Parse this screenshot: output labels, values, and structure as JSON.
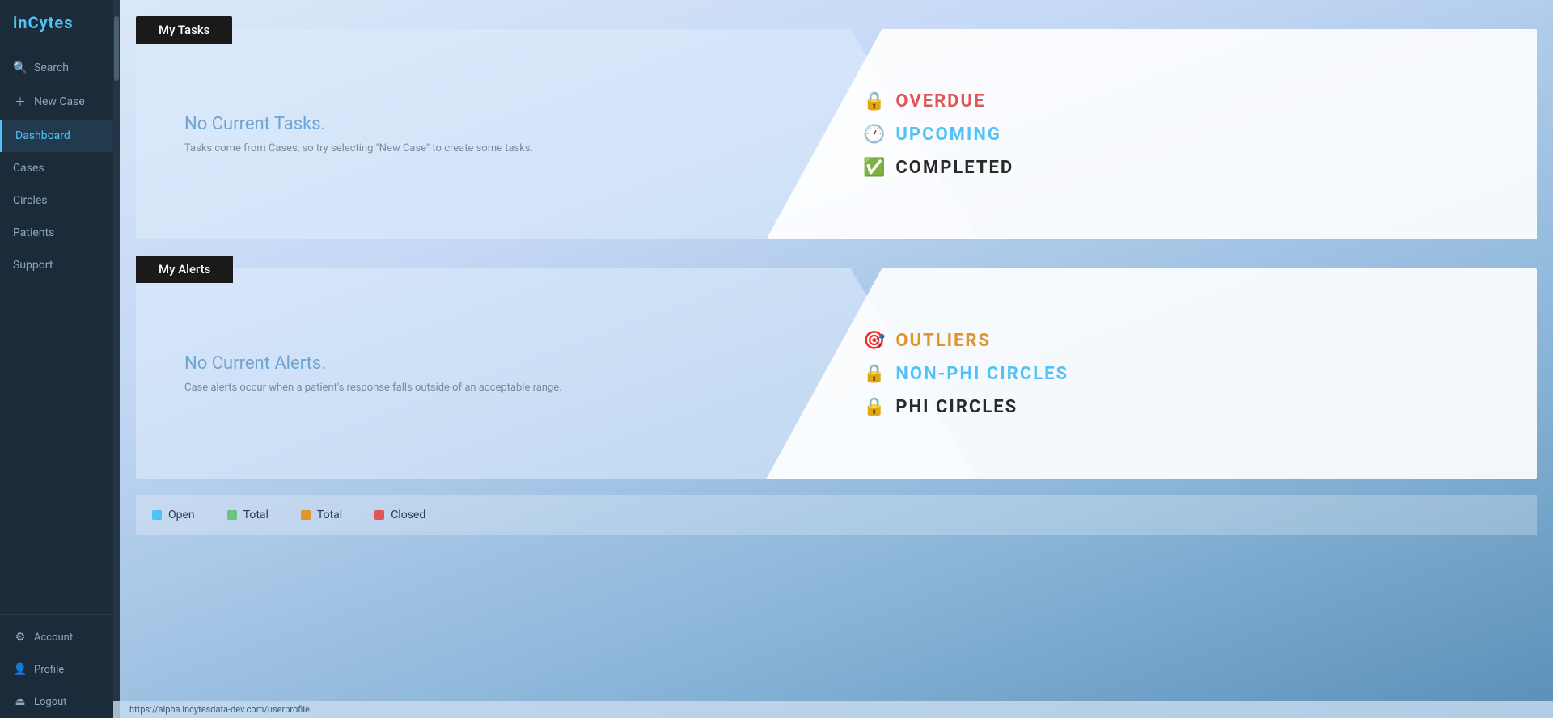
{
  "app": {
    "name": "inCytes"
  },
  "sidebar": {
    "logo": "inCytes",
    "items": [
      {
        "id": "search",
        "label": "Search",
        "icon": "🔍",
        "active": false
      },
      {
        "id": "new-case",
        "label": "New Case",
        "icon": "➕",
        "active": false
      },
      {
        "id": "dashboard",
        "label": "Dashboard",
        "icon": "",
        "active": true
      },
      {
        "id": "cases",
        "label": "Cases",
        "icon": "",
        "active": false
      },
      {
        "id": "circles",
        "label": "Circles",
        "icon": "",
        "active": false
      },
      {
        "id": "patients",
        "label": "Patients",
        "icon": "",
        "active": false
      },
      {
        "id": "support",
        "label": "Support",
        "icon": "",
        "active": false
      }
    ],
    "bottom_items": [
      {
        "id": "account",
        "label": "Account",
        "icon": "⚙"
      },
      {
        "id": "profile",
        "label": "Profile",
        "icon": "👤"
      },
      {
        "id": "logout",
        "label": "Logout",
        "icon": "⏏"
      }
    ]
  },
  "tasks_section": {
    "label": "My Tasks",
    "no_items_title": "No Current Tasks.",
    "no_items_subtitle": "Tasks come from Cases, so try selecting \"New Case\" to create some tasks.",
    "status_items": [
      {
        "id": "overdue",
        "label": "OVERDUE",
        "icon": "🔒",
        "color_class": "status-overdue"
      },
      {
        "id": "upcoming",
        "label": "UPCOMING",
        "icon": "🕐",
        "color_class": "status-upcoming"
      },
      {
        "id": "completed",
        "label": "COMPLETED",
        "icon": "✅",
        "color_class": "status-completed"
      }
    ]
  },
  "alerts_section": {
    "label": "My Alerts",
    "no_items_title": "No Current Alerts.",
    "no_items_subtitle": "Case alerts occur when a patient's response falls outside of an acceptable range.",
    "status_items": [
      {
        "id": "outliers",
        "label": "OUTLIERS",
        "icon": "🎯",
        "color_class": "status-outliers"
      },
      {
        "id": "nonphi",
        "label": "NON-PHI CIRCLES",
        "icon": "🔒",
        "color_class": "status-nonphi"
      },
      {
        "id": "phi",
        "label": "PHI CIRCLES",
        "icon": "🔒",
        "color_class": "status-phi"
      }
    ]
  },
  "bottom_stats": [
    {
      "id": "open",
      "label": "Open"
    },
    {
      "id": "total1",
      "label": "Total"
    },
    {
      "id": "total2",
      "label": "Total"
    },
    {
      "id": "closed",
      "label": "Closed"
    }
  ],
  "status_bar": {
    "url": "https://alpha.incytesdata-dev.com/userprofile"
  }
}
